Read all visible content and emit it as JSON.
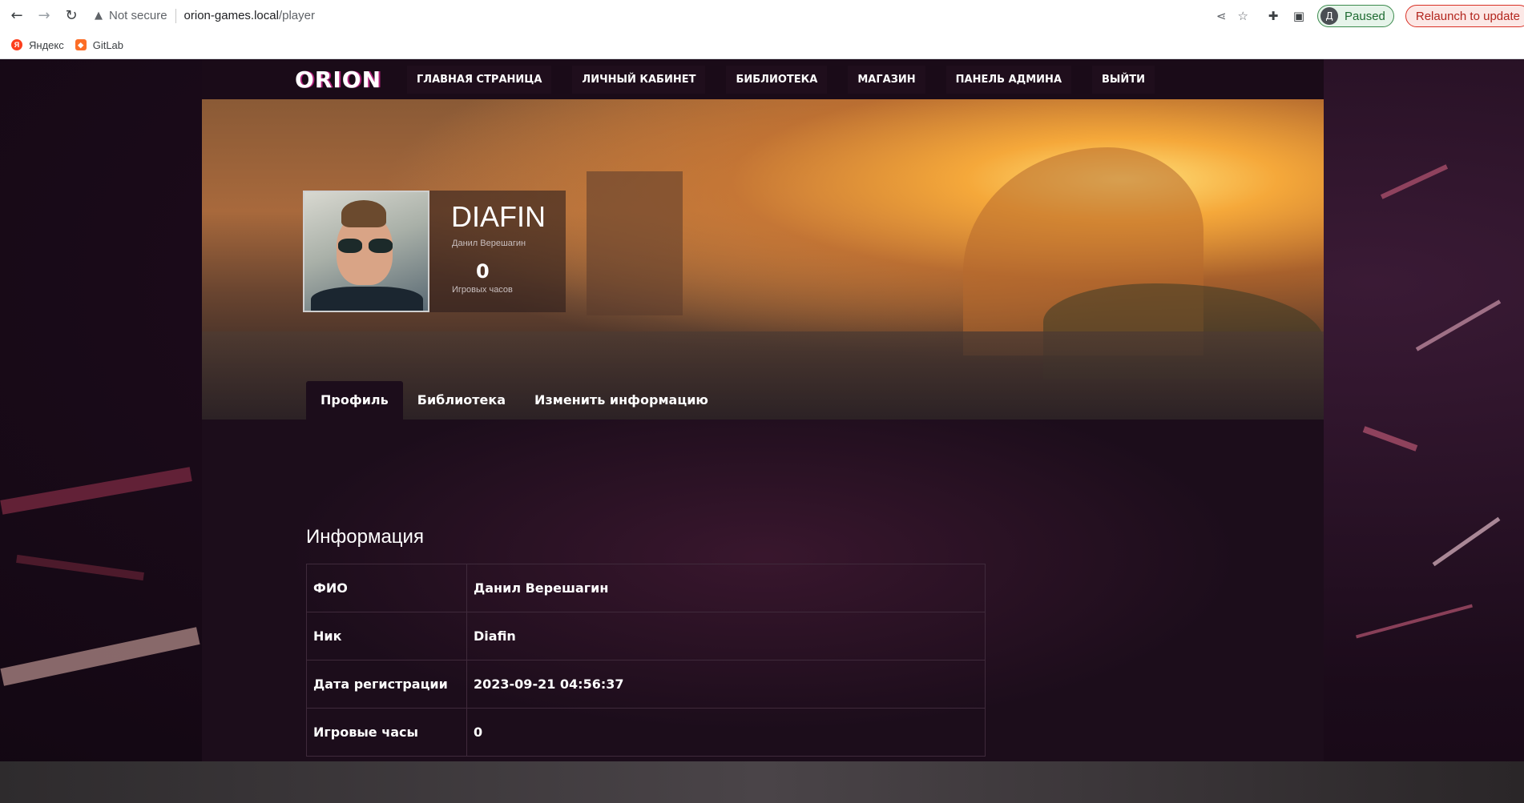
{
  "browser": {
    "security_label": "Not secure",
    "url_host": "orion-games.local",
    "url_path": "/player",
    "profile_initial": "Д",
    "profile_status": "Paused",
    "relaunch_label": "Relaunch to update"
  },
  "bookmarks": [
    {
      "label": "Яндекс",
      "icon": "yandex-icon"
    },
    {
      "label": "GitLab",
      "icon": "gitlab-icon"
    }
  ],
  "site": {
    "logo": "ORION",
    "nav": [
      "ГЛАВНАЯ СТРАНИЦА",
      "ЛИЧНЫЙ КАБИНЕТ",
      "БИБЛИОТЕКА",
      "МАГАЗИН",
      "ПАНЕЛЬ АДМИНА",
      "ВЫЙТИ"
    ]
  },
  "profile": {
    "nickname": "DIAFIN",
    "real_name": "Данил Верешагин",
    "hours": "0",
    "hours_label": "Игровых часов"
  },
  "tabs": [
    "Профиль",
    "Библиотека",
    "Изменить информацию"
  ],
  "info": {
    "title": "Информация",
    "rows": [
      {
        "key": "ФИО",
        "value": "Данил Верешагин"
      },
      {
        "key": "Ник",
        "value": "Diafin"
      },
      {
        "key": "Дата регистрации",
        "value": "2023-09-21 04:56:37"
      },
      {
        "key": "Игровые часы",
        "value": "0"
      }
    ]
  },
  "colors": {
    "accent": "#b0207a",
    "page_bg": "#1c0d1b",
    "profile_chip": "#e6f4ea",
    "relaunch": "#fce8e6"
  }
}
